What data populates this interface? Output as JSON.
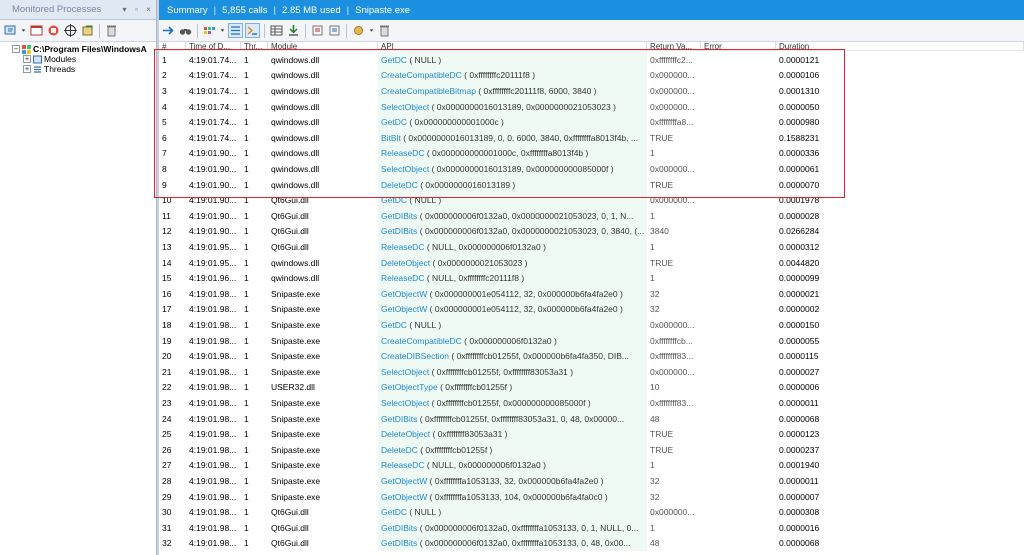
{
  "left_pane": {
    "title": "Monitored Processes",
    "controls": [
      "▾",
      "▫",
      "×"
    ],
    "toolbar_icons": [
      "monitor-new-icon",
      "dropdown-icon",
      "window-icon",
      "stop-icon",
      "target-icon",
      "export-icon",
      "delete-icon"
    ],
    "tree": {
      "root_expander": "−",
      "root_label": "C:\\Program Files\\WindowsA",
      "children": [
        {
          "expander": "+",
          "label": "Modules"
        },
        {
          "expander": "+",
          "label": "Threads"
        }
      ]
    }
  },
  "right_pane": {
    "tabbar": {
      "summary": "Summary",
      "sep": "|",
      "calls": "5,855 calls",
      "memory": "2.85 MB used",
      "process": "Snipaste.exe"
    },
    "toolbar_icons": [
      "arrow-right-icon",
      "binoculars-icon",
      "palette-icon",
      "view-toggle-icon",
      "view-active-icon",
      "table-icon",
      "download-icon",
      "import-icon",
      "export-icon",
      "record-icon",
      "delete-icon"
    ],
    "columns": {
      "num": "#",
      "time": "Time of D...",
      "thread": "Thr...",
      "module": "Module",
      "api": "API",
      "return": "Return Va...",
      "error": "Error",
      "duration": "Duration"
    },
    "rows": [
      {
        "n": "1",
        "time": "4:19:01.74...",
        "thr": "1",
        "mod": "qwindows.dll",
        "fn": "GetDC",
        "args": "( NULL )",
        "ret": "0xffffffffc2...",
        "dur": "0.0000121"
      },
      {
        "n": "2",
        "time": "4:19:01.74...",
        "thr": "1",
        "mod": "qwindows.dll",
        "fn": "CreateCompatibleDC",
        "args": "( 0xffffffffc20111f8 )",
        "ret": "0x000000...",
        "dur": "0.0000106"
      },
      {
        "n": "3",
        "time": "4:19:01.74...",
        "thr": "1",
        "mod": "qwindows.dll",
        "fn": "CreateCompatibleBitmap",
        "args": "( 0xffffffffc20111f8, 6000, 3840 )",
        "ret": "0x000000...",
        "dur": "0.0001310"
      },
      {
        "n": "4",
        "time": "4:19:01.74...",
        "thr": "1",
        "mod": "qwindows.dll",
        "fn": "SelectObject",
        "args": "( 0x0000000016013189, 0x0000000021053023 )",
        "ret": "0x000000...",
        "dur": "0.0000050"
      },
      {
        "n": "5",
        "time": "4:19:01.74...",
        "thr": "1",
        "mod": "qwindows.dll",
        "fn": "GetDC",
        "args": "( 0x000000000001000c )",
        "ret": "0xffffffffa8...",
        "dur": "0.0000980"
      },
      {
        "n": "6",
        "time": "4:19:01.74...",
        "thr": "1",
        "mod": "qwindows.dll",
        "fn": "BitBlt",
        "args": "( 0x0000000016013189, 0, 0, 6000, 3840, 0xffffffffa8013f4b, ...",
        "ret": "TRUE",
        "dur": "0.1588231"
      },
      {
        "n": "7",
        "time": "4:19:01.90...",
        "thr": "1",
        "mod": "qwindows.dll",
        "fn": "ReleaseDC",
        "args": "( 0x000000000001000c, 0xffffffffa8013f4b )",
        "ret": "1",
        "dur": "0.0000336"
      },
      {
        "n": "8",
        "time": "4:19:01.90...",
        "thr": "1",
        "mod": "qwindows.dll",
        "fn": "SelectObject",
        "args": "( 0x0000000016013189, 0x000000000085000f )",
        "ret": "0x000000...",
        "dur": "0.0000061"
      },
      {
        "n": "9",
        "time": "4:19:01.90...",
        "thr": "1",
        "mod": "qwindows.dll",
        "fn": "DeleteDC",
        "args": "( 0x0000000016013189 )",
        "ret": "TRUE",
        "dur": "0.0000070"
      },
      {
        "n": "10",
        "time": "4:19:01.90...",
        "thr": "1",
        "mod": "Qt6Gui.dll",
        "fn": "GetDC",
        "args": "( NULL )",
        "ret": "0x000000...",
        "dur": "0.0001978"
      },
      {
        "n": "11",
        "time": "4:19:01.90...",
        "thr": "1",
        "mod": "Qt6Gui.dll",
        "fn": "GetDIBits",
        "args": "( 0x000000006f0132a0, 0x0000000021053023, 0, 1, N...",
        "ret": "1",
        "dur": "0.0000028"
      },
      {
        "n": "12",
        "time": "4:19:01.90...",
        "thr": "1",
        "mod": "Qt6Gui.dll",
        "fn": "GetDIBits",
        "args": "( 0x000000006f0132a0, 0x0000000021053023, 0, 3840, (...",
        "ret": "3840",
        "dur": "0.0266284"
      },
      {
        "n": "13",
        "time": "4:19:01.95...",
        "thr": "1",
        "mod": "Qt6Gui.dll",
        "fn": "ReleaseDC",
        "args": "( NULL, 0x000000006f0132a0 )",
        "ret": "1",
        "dur": "0.0000312"
      },
      {
        "n": "14",
        "time": "4:19:01.95...",
        "thr": "1",
        "mod": "qwindows.dll",
        "fn": "DeleteObject",
        "args": "( 0x0000000021053023 )",
        "ret": "TRUE",
        "dur": "0.0044820"
      },
      {
        "n": "15",
        "time": "4:19:01.96...",
        "thr": "1",
        "mod": "qwindows.dll",
        "fn": "ReleaseDC",
        "args": "( NULL, 0xffffffffc20111f8 )",
        "ret": "1",
        "dur": "0.0000099"
      },
      {
        "n": "16",
        "time": "4:19:01.98...",
        "thr": "1",
        "mod": "Snipaste.exe",
        "fn": "GetObjectW",
        "args": "( 0x000000001e054112, 32, 0x000000b6fa4fa2e0 )",
        "ret": "32",
        "dur": "0.0000021"
      },
      {
        "n": "17",
        "time": "4:19:01.98...",
        "thr": "1",
        "mod": "Snipaste.exe",
        "fn": "GetObjectW",
        "args": "( 0x000000001e054112, 32, 0x000000b6fa4fa2e0 )",
        "ret": "32",
        "dur": "0.0000002"
      },
      {
        "n": "18",
        "time": "4:19:01.98...",
        "thr": "1",
        "mod": "Snipaste.exe",
        "fn": "GetDC",
        "args": "( NULL )",
        "ret": "0x000000...",
        "dur": "0.0000150"
      },
      {
        "n": "19",
        "time": "4:19:01.98...",
        "thr": "1",
        "mod": "Snipaste.exe",
        "fn": "CreateCompatibleDC",
        "args": "( 0x000000006f0132a0 )",
        "ret": "0xffffffffcb...",
        "dur": "0.0000055"
      },
      {
        "n": "20",
        "time": "4:19:01.98...",
        "thr": "1",
        "mod": "Snipaste.exe",
        "fn": "CreateDIBSection",
        "args": "( 0xffffffffcb01255f, 0x000000b6fa4fa350, DIB...",
        "ret": "0xffffffff83...",
        "dur": "0.0000115"
      },
      {
        "n": "21",
        "time": "4:19:01.98...",
        "thr": "1",
        "mod": "Snipaste.exe",
        "fn": "SelectObject",
        "args": "( 0xffffffffcb01255f, 0xffffffff83053a31 )",
        "ret": "0x000000...",
        "dur": "0.0000027"
      },
      {
        "n": "22",
        "time": "4:19:01.98...",
        "thr": "1",
        "mod": "USER32.dll",
        "fn": "GetObjectType",
        "args": "( 0xffffffffcb01255f )",
        "ret": "10",
        "dur": "0.0000006"
      },
      {
        "n": "23",
        "time": "4:19:01.98...",
        "thr": "1",
        "mod": "Snipaste.exe",
        "fn": "SelectObject",
        "args": "( 0xffffffffcb01255f, 0x000000000085000f )",
        "ret": "0xffffffff83...",
        "dur": "0.0000011"
      },
      {
        "n": "24",
        "time": "4:19:01.98...",
        "thr": "1",
        "mod": "Snipaste.exe",
        "fn": "GetDIBits",
        "args": "( 0xffffffffcb01255f, 0xffffffff83053a31, 0, 48, 0x00000...",
        "ret": "48",
        "dur": "0.0000068"
      },
      {
        "n": "25",
        "time": "4:19:01.98...",
        "thr": "1",
        "mod": "Snipaste.exe",
        "fn": "DeleteObject",
        "args": "( 0xffffffff83053a31 )",
        "ret": "TRUE",
        "dur": "0.0000123"
      },
      {
        "n": "26",
        "time": "4:19:01.98...",
        "thr": "1",
        "mod": "Snipaste.exe",
        "fn": "DeleteDC",
        "args": "( 0xffffffffcb01255f )",
        "ret": "TRUE",
        "dur": "0.0000237"
      },
      {
        "n": "27",
        "time": "4:19:01.98...",
        "thr": "1",
        "mod": "Snipaste.exe",
        "fn": "ReleaseDC",
        "args": "( NULL, 0x000000006f0132a0 )",
        "ret": "1",
        "dur": "0.0001940"
      },
      {
        "n": "28",
        "time": "4:19:01.98...",
        "thr": "1",
        "mod": "Snipaste.exe",
        "fn": "GetObjectW",
        "args": "( 0xffffffffa1053133, 32, 0x000000b6fa4fa2e0 )",
        "ret": "32",
        "dur": "0.0000011"
      },
      {
        "n": "29",
        "time": "4:19:01.98...",
        "thr": "1",
        "mod": "Snipaste.exe",
        "fn": "GetObjectW",
        "args": "( 0xffffffffa1053133, 104, 0x000000b6fa4fa0c0 )",
        "ret": "32",
        "dur": "0.0000007"
      },
      {
        "n": "30",
        "time": "4:19:01.98...",
        "thr": "1",
        "mod": "Qt6Gui.dll",
        "fn": "GetDC",
        "args": "( NULL )",
        "ret": "0x000000...",
        "dur": "0.0000308"
      },
      {
        "n": "31",
        "time": "4:19:01.98...",
        "thr": "1",
        "mod": "Qt6Gui.dll",
        "fn": "GetDIBits",
        "args": "( 0x000000006f0132a0, 0xffffffffa1053133, 0, 1, NULL, 0...",
        "ret": "1",
        "dur": "0.0000016"
      },
      {
        "n": "32",
        "time": "4:19:01.98...",
        "thr": "1",
        "mod": "Qt6Gui.dll",
        "fn": "GetDIBits",
        "args": "( 0x000000006f0132a0, 0xffffffffa1053133, 0, 48, 0x00...",
        "ret": "48",
        "dur": "0.0000068"
      }
    ]
  },
  "colors": {
    "accent": "#1b8fe0",
    "api_link": "#1e8bd1",
    "highlight": "#e0242f",
    "api_column_bg": "#f0faf5"
  }
}
